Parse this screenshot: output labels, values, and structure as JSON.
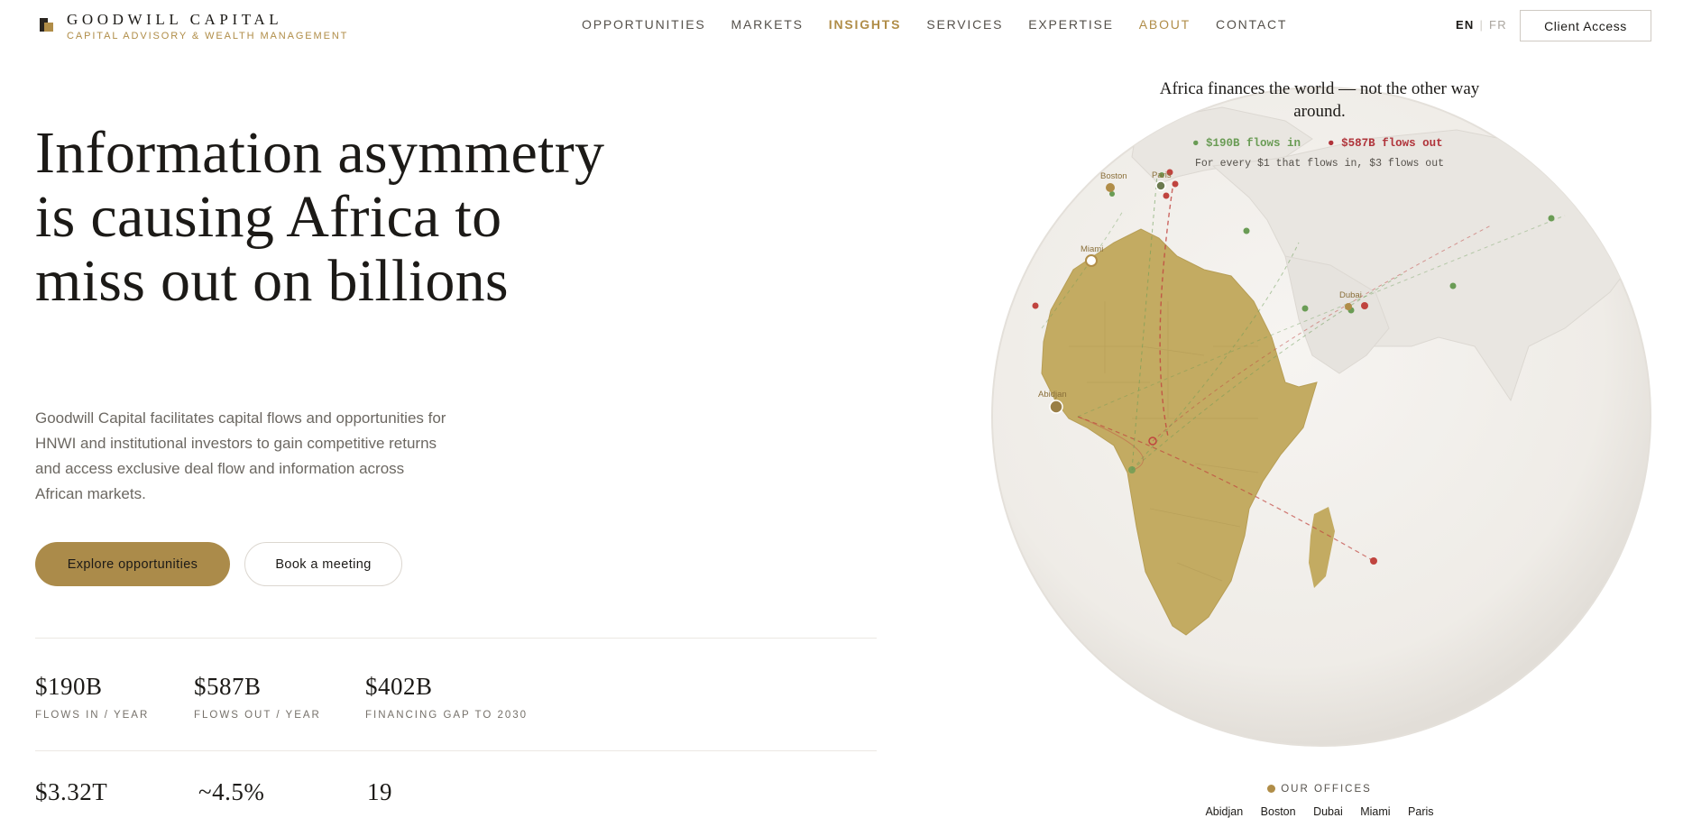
{
  "brand": {
    "name": "GOODWILL CAPITAL",
    "tagline": "CAPITAL ADVISORY & WEALTH MANAGEMENT"
  },
  "nav": {
    "items": [
      "OPPORTUNITIES",
      "MARKETS",
      "INSIGHTS",
      "SERVICES",
      "EXPERTISE",
      "ABOUT",
      "CONTACT"
    ],
    "active": "INSIGHTS"
  },
  "lang": {
    "en": "EN",
    "separator": "|",
    "fr": "FR",
    "selected": "EN"
  },
  "header": {
    "client_access": "Client Access"
  },
  "hero": {
    "title": "Information asymmetry is causing Africa to miss out on billions",
    "subtitle": "Goodwill Capital facilitates capital flows and opportunities for HNWI and institutional investors to gain competitive returns and access exclusive deal flow and information across African markets.",
    "cta_primary": "Explore opportunities",
    "cta_secondary": "Book a meeting"
  },
  "stats": [
    {
      "value": "$190B",
      "label": "FLOWS IN / YEAR"
    },
    {
      "value": "$587B",
      "label": "FLOWS OUT / YEAR"
    },
    {
      "value": "$402B",
      "label": "FINANCING GAP TO 2030"
    },
    {
      "value": "$3.32T",
      "label": ""
    },
    {
      "value": "~4.5%",
      "label": ""
    },
    {
      "value": "19",
      "label": ""
    }
  ],
  "globe": {
    "headline": "Africa finances the world — not the other way around.",
    "legend_in": "$190B flows in",
    "legend_out": "$587B flows out",
    "legend_note": "For every $1 that flows in, $3 flows out",
    "city_labels": [
      "Boston",
      "Paris",
      "Miami",
      "Dubai",
      "Abidjan"
    ],
    "colors": {
      "land": "#c3ab62",
      "flow_in": "#6a9c55",
      "flow_out": "#c0443f",
      "office": "#b08d48"
    }
  },
  "offices": {
    "heading": "OUR OFFICES",
    "list": [
      "Abidjan",
      "Boston",
      "Dubai",
      "Miami",
      "Paris"
    ]
  }
}
